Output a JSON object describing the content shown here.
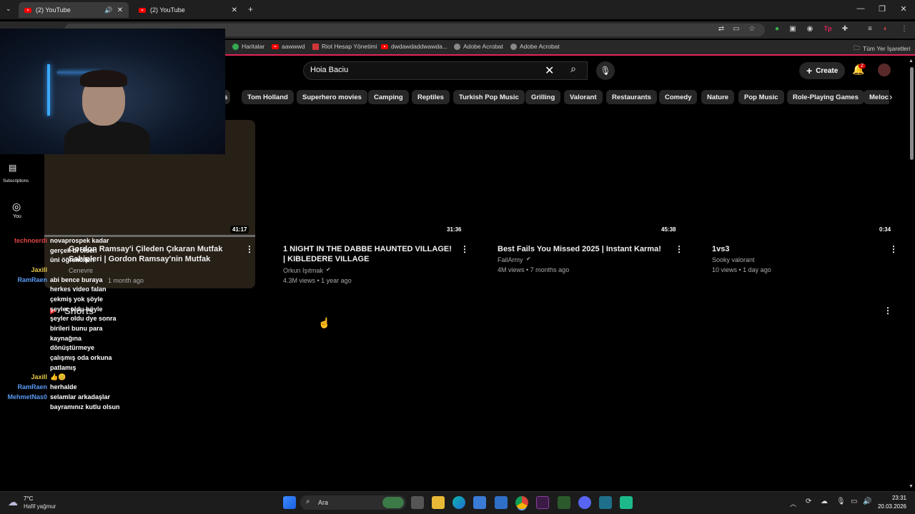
{
  "browser": {
    "tabs": [
      {
        "title": "(2) YouTube",
        "active": true
      },
      {
        "title": "(2) YouTube",
        "active": false
      }
    ],
    "bookmarks": [
      "Haritalar",
      "aawwwd",
      "Riot Hesap Yönetimi",
      "dwdawdaddwawda...",
      "Adobe Acrobat",
      "Adobe Acrobat"
    ],
    "all_bookmarks": "Tüm Yer İşaretleri"
  },
  "youtube": {
    "search_value": "Hoia Baciu",
    "create_label": "Create",
    "notification_count": "2",
    "chips": [
      "es",
      "Tom Holland",
      "Superhero movies",
      "Camping",
      "Reptiles",
      "Turkish Pop Music",
      "Grilling",
      "Valorant",
      "Restaurants",
      "Comedy",
      "Nature",
      "Pop Music",
      "Role-Playing Games",
      "Meloc"
    ],
    "sidebar": {
      "subscriptions": "Subscriptions",
      "you": "You"
    },
    "videos": [
      {
        "duration": "41:17",
        "title": "Gordon Ramsay'i Çileden Çıkaran Mutfak Sahipleri | Gordon Ramsay'nin Mutfak Kâbusları ...",
        "channel": "Cenevre",
        "meta": "1 month ago"
      },
      {
        "duration": "31:36",
        "title": "1 NIGHT IN THE DABBE HAUNTED VILLAGE! | KIBLEDERE VILLAGE",
        "channel": "Orkun Işıtmak",
        "meta": "4.3M views • 1 year ago"
      },
      {
        "duration": "45:38",
        "title": "Best Fails You Missed 2025 | Instant Karma!",
        "channel": "FailArmy",
        "meta": "4M views • 7 months ago"
      },
      {
        "duration": "0:34",
        "title": "1vs3",
        "channel": "Sooky valorant",
        "meta": "10 views • 1 day ago"
      }
    ],
    "shorts_label": "Shorts"
  },
  "chat": [
    {
      "user": "technoerdi",
      "color": "#e04545",
      "msg": "novaprospek kadar"
    },
    {
      "user": "",
      "color": "",
      "msg": "gerçek bi olsen"
    },
    {
      "user": "",
      "color": "",
      "msg": "üni öğrencileri"
    },
    {
      "user": "Jaxill",
      "color": "#e6c84a",
      "msg": ""
    },
    {
      "user": "RamRaen",
      "color": "#5b9bf5",
      "msg": "abi bence buraya"
    },
    {
      "user": "",
      "color": "",
      "msg": "herkes video falan"
    },
    {
      "user": "",
      "color": "",
      "msg": "çekmiş yok şöyle"
    },
    {
      "user": "",
      "color": "",
      "msg": "şeyler oldu böyle"
    },
    {
      "user": "",
      "color": "",
      "msg": "şeyler oldu dye sonra"
    },
    {
      "user": "",
      "color": "",
      "msg": "birileri bunu para"
    },
    {
      "user": "",
      "color": "",
      "msg": "kaynağına"
    },
    {
      "user": "",
      "color": "",
      "msg": "dönüştürmeye"
    },
    {
      "user": "",
      "color": "",
      "msg": "çalışmış oda orkuna"
    },
    {
      "user": "",
      "color": "",
      "msg": "patlamış"
    },
    {
      "user": "Jaxill",
      "color": "#e6c84a",
      "msg": "👍😊"
    },
    {
      "user": "RamRaen",
      "color": "#5b9bf5",
      "msg": "herhalde"
    },
    {
      "user": "MehmetNas0",
      "color": "#5b9bf5",
      "msg": "selamlar arkadaşlar"
    },
    {
      "user": "",
      "color": "",
      "msg": "bayramınız kutlu olsun"
    }
  ],
  "taskbar": {
    "weather_temp": "7°C",
    "weather_desc": "Hafif yağmur",
    "search_label": "Ara",
    "time": "23:31",
    "date": "20.03.2026"
  }
}
